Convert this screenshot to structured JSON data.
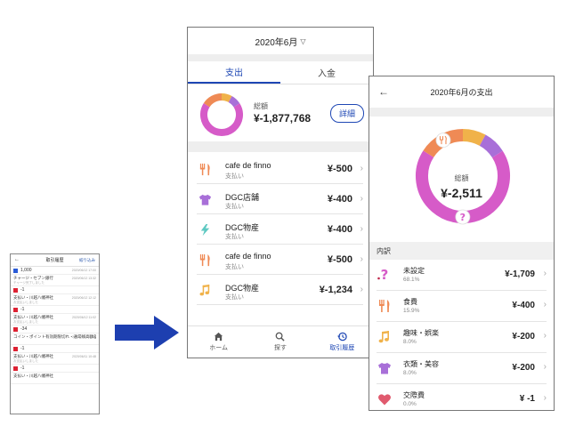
{
  "colors": {
    "accent": "#1e47b4",
    "arrow": "#1d3fb0",
    "unset": "#d65bc8",
    "food": "#ef8a55",
    "hobby": "#f0b24a",
    "clothing": "#a86fd8",
    "social": "#e05a6e"
  },
  "mini": {
    "title": "取引履歴",
    "filter": "絞り込み",
    "rows": [
      {
        "type": "amount",
        "text": "1,000",
        "date": "2020/06/12 17:00",
        "color": "blue"
      },
      {
        "type": "item",
        "text": "チャージ・セブン銀行",
        "sub": "チャージ完了しました",
        "date": "2020/06/12 13:32"
      },
      {
        "type": "amount",
        "text": "-1",
        "date": "",
        "color": "red"
      },
      {
        "type": "item",
        "text": "支払い・川越八幡神社",
        "sub": "お支払いしました",
        "date": "2020/06/12 12:12"
      },
      {
        "type": "amount",
        "text": "-1",
        "date": "",
        "color": "red"
      },
      {
        "type": "item",
        "text": "支払い・川越八幡神社",
        "sub": "お支払いしました",
        "date": "2020/06/12 11:02"
      },
      {
        "type": "amount",
        "text": "-34",
        "date": "",
        "color": "red"
      },
      {
        "type": "item",
        "text": "コイン・ポイント有効期限切れ・通常残高額差分",
        "sub": "",
        "date": "2020/06/11 12:00"
      },
      {
        "type": "amount",
        "text": "-1",
        "date": "",
        "color": "red"
      },
      {
        "type": "item",
        "text": "支払い・川越八幡神社",
        "sub": "お支払いしました",
        "date": "2020/06/11 10:48"
      },
      {
        "type": "amount",
        "text": "-1",
        "date": "",
        "color": "red"
      },
      {
        "type": "item",
        "text": "支払い・川越八幡神社",
        "sub": "",
        "date": ""
      }
    ]
  },
  "main": {
    "month": "2020年6月",
    "tabs": [
      "支出",
      "入金"
    ],
    "summary_label": "総額",
    "summary_value": "¥-1,877,768",
    "detail_button": "詳細",
    "transactions": [
      {
        "icon": "fork-knife-icon",
        "name": "cafe de finno",
        "sub": "支払い",
        "amount": "¥-500"
      },
      {
        "icon": "tshirt-icon",
        "name": "DGC店舗",
        "sub": "支払い",
        "amount": "¥-400"
      },
      {
        "icon": "lightning-icon",
        "name": "DGC物産",
        "sub": "支払い",
        "amount": "¥-400"
      },
      {
        "icon": "fork-knife-icon",
        "name": "cafe de finno",
        "sub": "支払い",
        "amount": "¥-500"
      },
      {
        "icon": "music-note-icon",
        "name": "DGC物産",
        "sub": "支払い",
        "amount": "¥-1,234"
      }
    ],
    "nav": [
      "ホーム",
      "探す",
      "取引履歴"
    ]
  },
  "detail": {
    "title": "2020年6月の支出",
    "total_label": "総額",
    "total_value": "¥-2,511",
    "breakdown_label": "内訳",
    "categories": [
      {
        "icon": "question-icon",
        "name": "未設定",
        "percent": "68.1%",
        "amount": "¥-1,709",
        "share": 68.1
      },
      {
        "icon": "fork-knife-icon",
        "name": "食費",
        "percent": "15.9%",
        "amount": "¥-400",
        "share": 15.9
      },
      {
        "icon": "music-note-icon",
        "name": "趣味・娯楽",
        "percent": "8.0%",
        "amount": "¥-200",
        "share": 8.0
      },
      {
        "icon": "tshirt-icon",
        "name": "衣類・美容",
        "percent": "8.0%",
        "amount": "¥-200",
        "share": 8.0
      },
      {
        "icon": "heart-icon",
        "name": "交際費",
        "percent": "0.0%",
        "amount": "¥ -1",
        "share": 0.0
      }
    ]
  }
}
